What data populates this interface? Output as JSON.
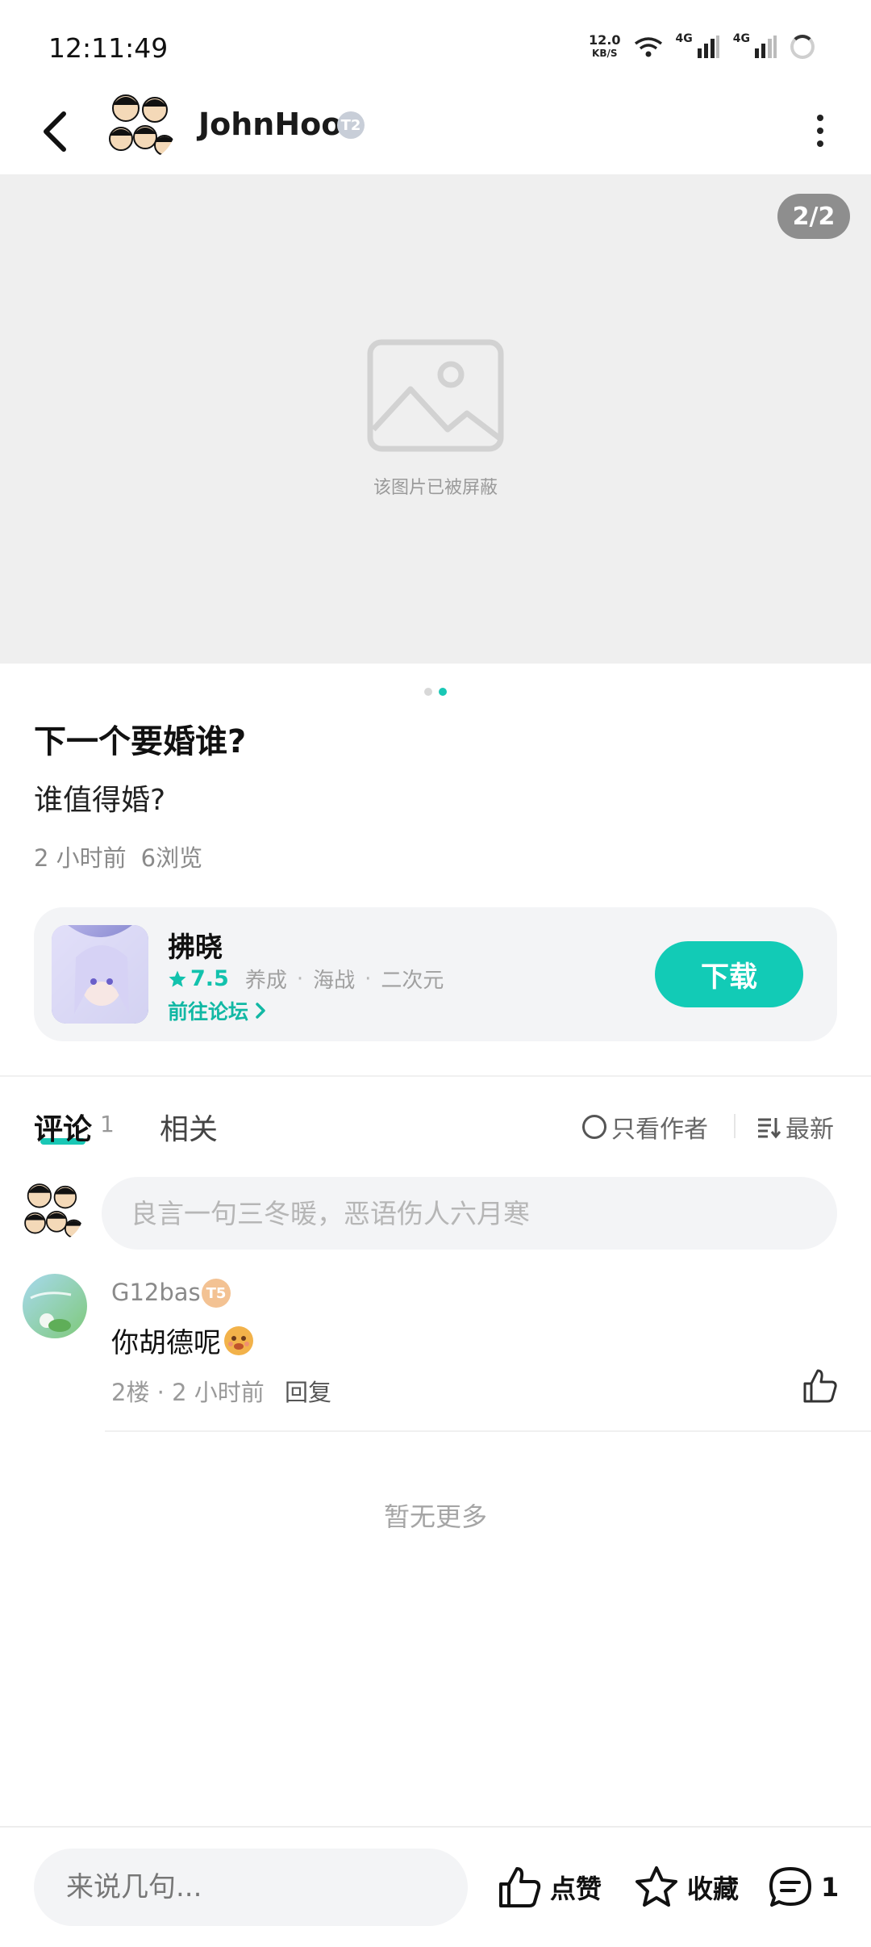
{
  "status_bar": {
    "time": "12:11:49",
    "net_speed_value": "12.0",
    "net_speed_unit": "KB/S",
    "signal1_label": "4G",
    "signal2_label": "4G"
  },
  "header": {
    "username": "JohnHoo",
    "badge": "T2"
  },
  "image_viewer": {
    "counter": "2/2",
    "blocked_text": "该图片已被屏蔽"
  },
  "post": {
    "title": "下一个要婚谁?",
    "body": "谁值得婚?",
    "time_ago": "2 小时前",
    "views": "6浏览"
  },
  "game_card": {
    "name": "拂晓",
    "rating": "7.5",
    "tags": [
      "养成",
      "海战",
      "二次元"
    ],
    "forum_link": "前往论坛",
    "download_label": "下载"
  },
  "tabs": {
    "comments_label": "评论",
    "comments_count": "1",
    "related_label": "相关",
    "author_only_label": "只看作者",
    "sort_label": "最新"
  },
  "comment_input": {
    "placeholder": "良言一句三冬暖，恶语伤人六月寒"
  },
  "comments": [
    {
      "user": "G12bas",
      "badge": "T5",
      "text": "你胡德呢",
      "floor": "2楼",
      "time_ago": "2 小时前",
      "reply_label": "回复"
    }
  ],
  "no_more": "暂无更多",
  "bottom_bar": {
    "input_placeholder": "来说几句...",
    "like_label": "点赞",
    "favorite_label": "收藏",
    "comment_count": "1"
  },
  "colors": {
    "accent": "#12cbb6",
    "text_primary": "#111111",
    "text_secondary": "#8a8a8a",
    "card_bg": "#f3f4f6",
    "image_placeholder_bg": "#efefef"
  },
  "icons": [
    "back-arrow-icon",
    "more-vertical-icon",
    "image-blocked-icon",
    "star-icon",
    "chevron-right-icon",
    "sort-icon",
    "thumbs-up-icon",
    "star-outline-icon",
    "comment-bubble-icon",
    "wifi-icon",
    "signal-icon",
    "loading-icon"
  ]
}
